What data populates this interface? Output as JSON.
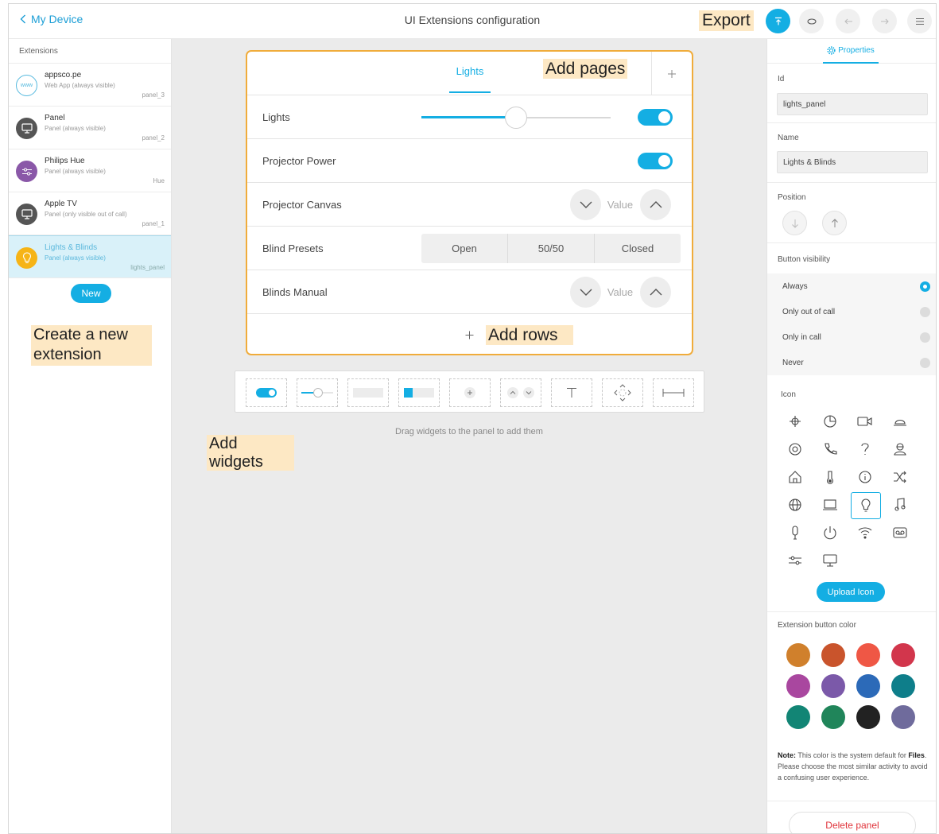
{
  "topbar": {
    "back_label": "My Device",
    "title": "UI Extensions configuration",
    "export_note": "Export"
  },
  "sidebar": {
    "header": "Extensions",
    "items": [
      {
        "name": "appsco.pe",
        "sub": "Web App (always visible)",
        "id": "panel_3",
        "icon": "www-icon",
        "color": "#ffffff",
        "icon_text": "www"
      },
      {
        "name": "Panel",
        "sub": "Panel (always visible)",
        "id": "panel_2",
        "icon": "monitor-icon",
        "color": "#555555"
      },
      {
        "name": "Philips Hue",
        "sub": "Panel (always visible)",
        "id": "Hue",
        "icon": "sliders-icon",
        "color": "#8a58a8"
      },
      {
        "name": "Apple TV",
        "sub": "Panel (only visible out of call)",
        "id": "panel_1",
        "icon": "monitor-icon",
        "color": "#555555"
      },
      {
        "name": "Lights & Blinds",
        "sub": "Panel (always visible)",
        "id": "lights_panel",
        "icon": "lightbulb-icon",
        "color": "#f6b416"
      }
    ],
    "new_label": "New",
    "note_create": [
      "Create a new",
      "extension"
    ],
    "note_widgets": [
      "Add",
      "widgets"
    ]
  },
  "panel": {
    "page_tab": "Lights",
    "note_pages": "Add pages",
    "rows": [
      {
        "label": "Lights",
        "slider_value": 50,
        "toggle_on": true
      },
      {
        "label": "Projector Power",
        "toggle_on": true
      },
      {
        "label": "Projector Canvas",
        "value_text": "Value"
      },
      {
        "label": "Blind Presets",
        "options": [
          "Open",
          "50/50",
          "Closed"
        ]
      },
      {
        "label": "Blinds Manual",
        "value_text": "Value"
      }
    ],
    "note_rows": "Add rows"
  },
  "widgets": {
    "items": [
      "toggle",
      "slider",
      "button",
      "toggle-button",
      "spinner",
      "up-down",
      "text",
      "directional-pad",
      "spacer"
    ],
    "hint": "Drag widgets to the panel to add them"
  },
  "properties": {
    "tab_label": "Properties",
    "id_label": "Id",
    "id_value": "lights_panel",
    "name_label": "Name",
    "name_value": "Lights & Blinds",
    "position_label": "Position",
    "visibility_label": "Button visibility",
    "visibility_options": [
      "Always",
      "Only out of call",
      "Only in call",
      "Never"
    ],
    "visibility_selected": 0,
    "icon_label": "Icon",
    "icons": [
      "briefcase",
      "pie-chart",
      "video-camera",
      "alarm-bell",
      "target",
      "phone",
      "question-mark",
      "concierge",
      "home",
      "thermometer",
      "info",
      "shuffle",
      "globe",
      "laptop",
      "lightbulb",
      "music-note",
      "microphone",
      "power",
      "wifi",
      "voicemail",
      "sliders",
      "monitor"
    ],
    "icon_selected": "lightbulb",
    "upload_label": "Upload Icon",
    "color_label": "Extension button color",
    "colors": [
      "#d0802c",
      "#c9542c",
      "#ef5745",
      "#d2364c",
      "#a9479f",
      "#7b59a9",
      "#2c6ab8",
      "#0e7e8a",
      "#128575",
      "#20855a",
      "#222222",
      "#6f6b9c"
    ],
    "note_prefix": "Note:",
    "note_text_1": " This color is the system default for ",
    "note_bold": "Files",
    "note_text_2": ". Please choose the most similar activity to avoid a confusing user experience.",
    "delete_label": "Delete panel"
  }
}
